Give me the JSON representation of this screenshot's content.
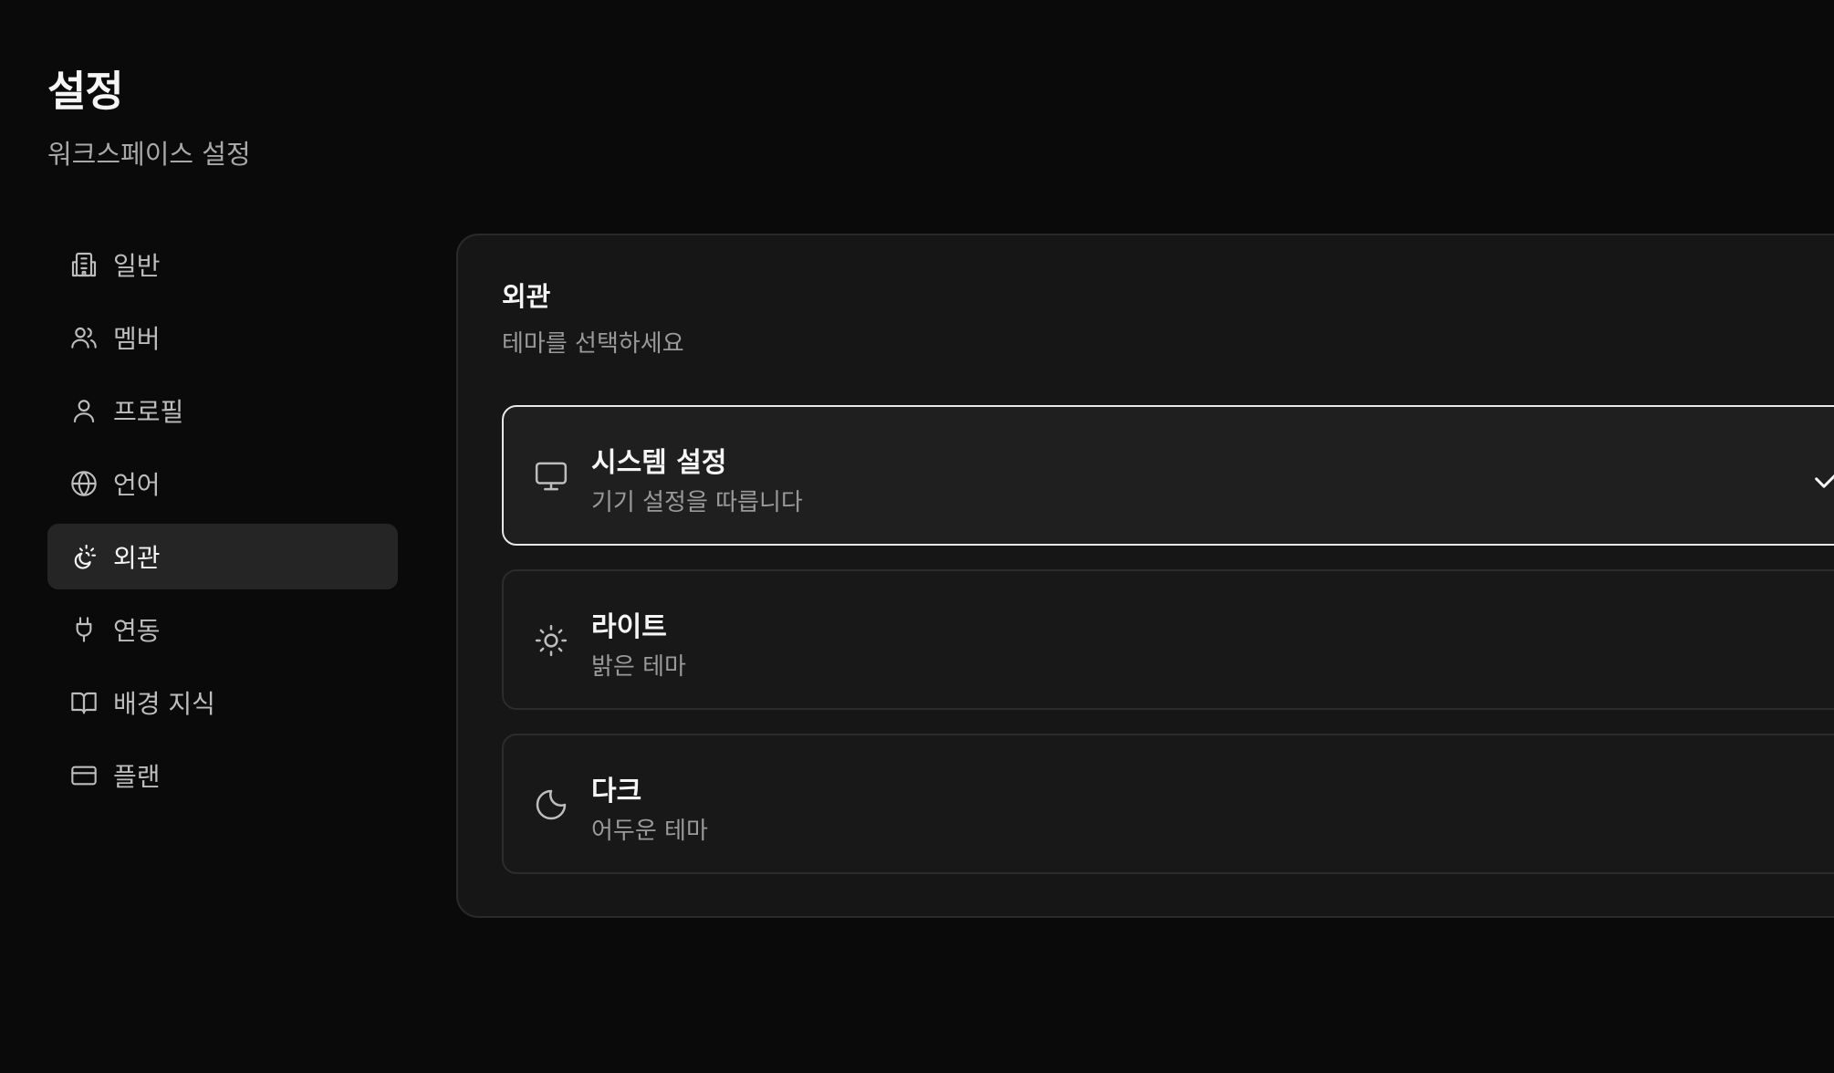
{
  "header": {
    "title": "설정",
    "subtitle": "워크스페이스 설정"
  },
  "sidebar": {
    "items": [
      {
        "label": "일반",
        "icon": "building-icon",
        "active": false
      },
      {
        "label": "멤버",
        "icon": "users-icon",
        "active": false
      },
      {
        "label": "프로필",
        "icon": "user-icon",
        "active": false
      },
      {
        "label": "언어",
        "icon": "globe-icon",
        "active": false
      },
      {
        "label": "외관",
        "icon": "sun-moon-icon",
        "active": true
      },
      {
        "label": "연동",
        "icon": "plug-icon",
        "active": false
      },
      {
        "label": "배경 지식",
        "icon": "book-open-icon",
        "active": false
      },
      {
        "label": "플랜",
        "icon": "credit-card-icon",
        "active": false
      }
    ]
  },
  "appearance": {
    "title": "외관",
    "subtitle": "테마를 선택하세요",
    "options": [
      {
        "title": "시스템 설정",
        "description": "기기 설정을 따릅니다",
        "icon": "monitor-icon",
        "selected": true
      },
      {
        "title": "라이트",
        "description": "밝은 테마",
        "icon": "sun-icon",
        "selected": false
      },
      {
        "title": "다크",
        "description": "어두운 테마",
        "icon": "moon-icon",
        "selected": false
      }
    ]
  },
  "colors": {
    "background": "#0a0a0a",
    "panel": "#161616",
    "active_nav": "#252525",
    "selected_border": "#e8e8e8"
  }
}
